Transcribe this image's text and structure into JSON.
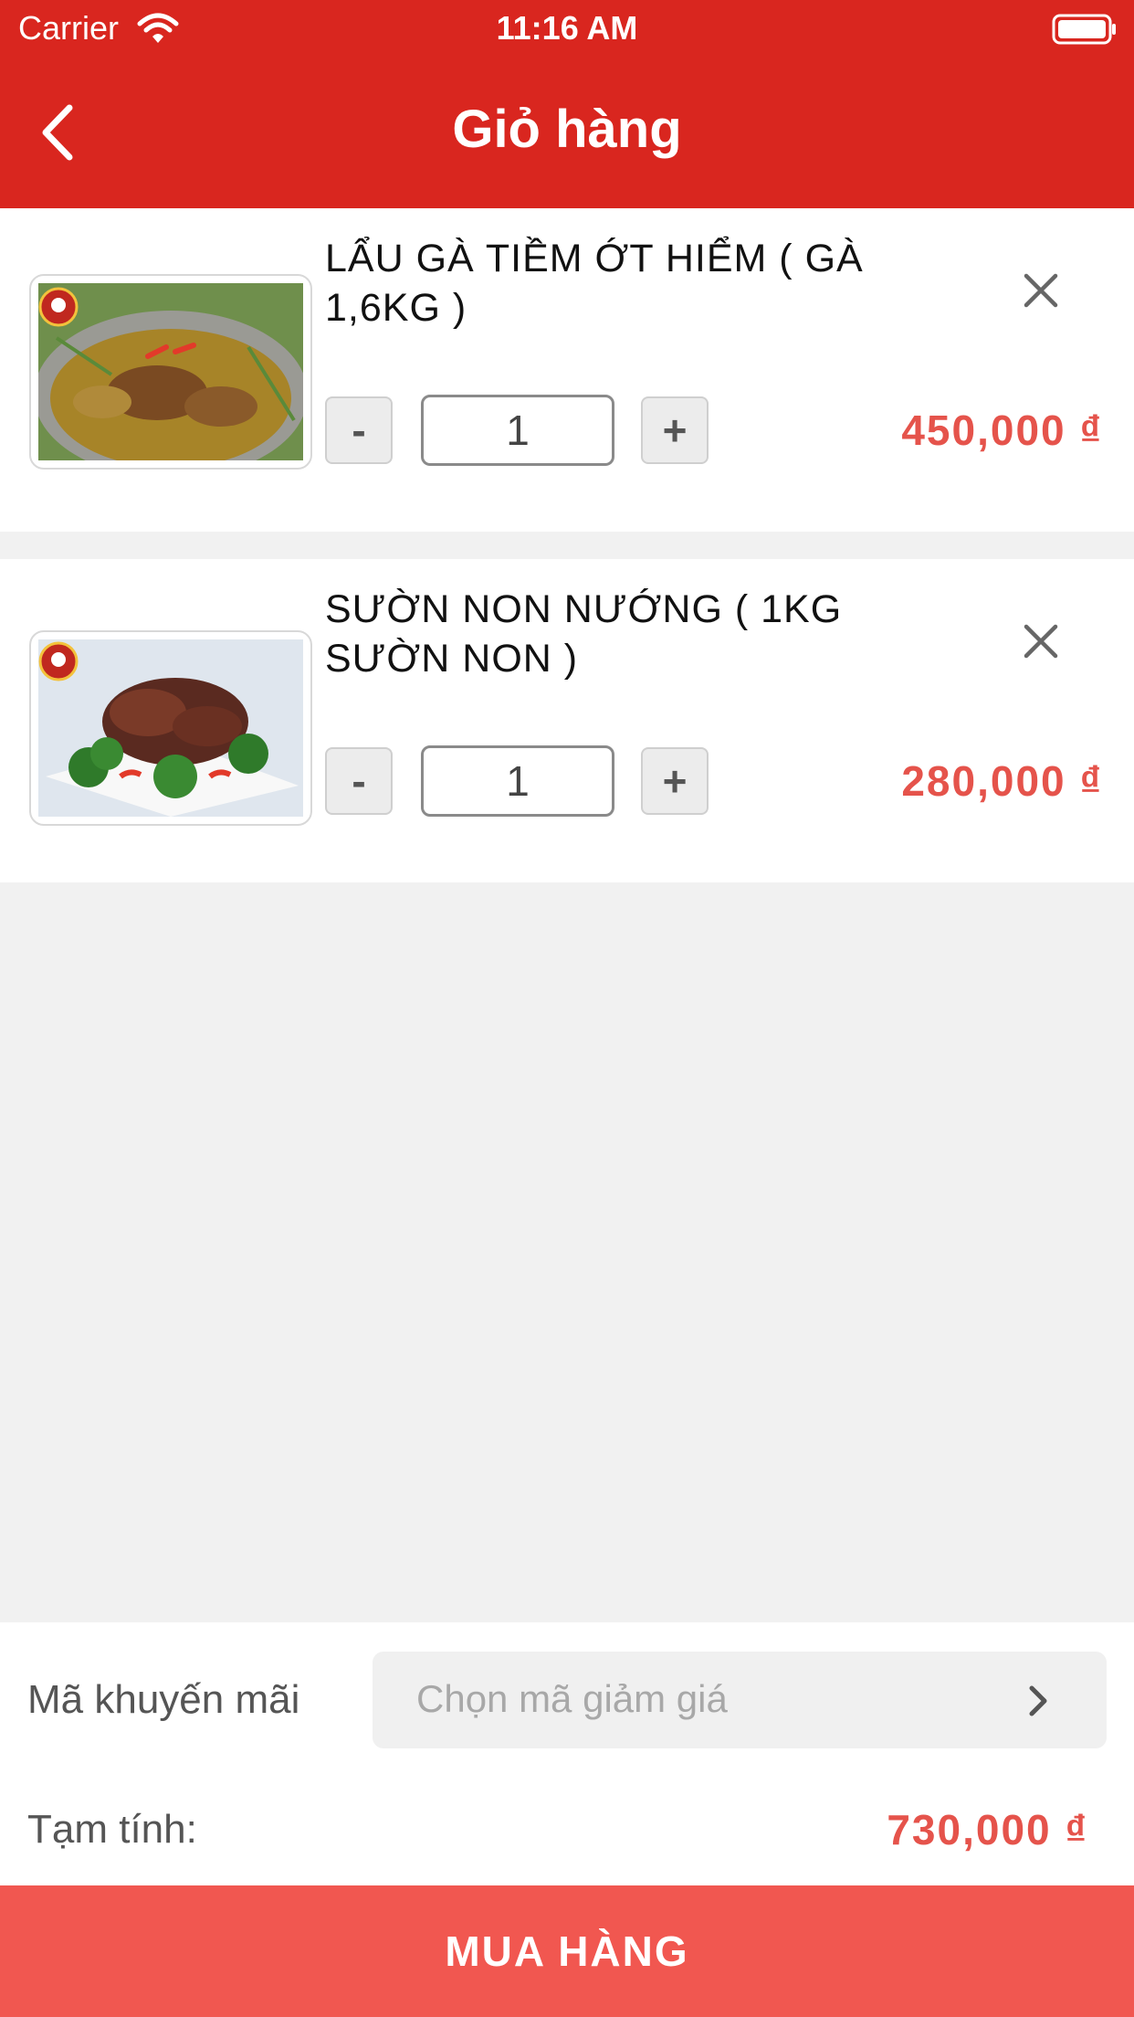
{
  "status_bar": {
    "carrier": "Carrier",
    "time": "11:16 AM"
  },
  "header": {
    "title": "Giỏ hàng",
    "back_icon": "chevron-left-icon"
  },
  "cart": {
    "items": [
      {
        "name": "LẨU GÀ TIỀM ỚT HIỂM ( GÀ 1,6KG )",
        "quantity": "1",
        "minus_label": "-",
        "plus_label": "+",
        "price": "450,000 ₫"
      },
      {
        "name": "SƯỜN NON NƯỚNG ( 1KG SƯỜN NON )",
        "quantity": "1",
        "minus_label": "-",
        "plus_label": "+",
        "price": "280,000 ₫"
      }
    ]
  },
  "promo": {
    "label": "Mã khuyến mãi",
    "placeholder": "Chọn mã giảm giá"
  },
  "summary": {
    "subtotal_label": "Tạm tính:",
    "subtotal_value": "730,000 ₫"
  },
  "checkout": {
    "label": "MUA HÀNG"
  },
  "colors": {
    "header_bg": "#d9261f",
    "price": "#e5534b",
    "checkout_bg": "#f15750"
  }
}
